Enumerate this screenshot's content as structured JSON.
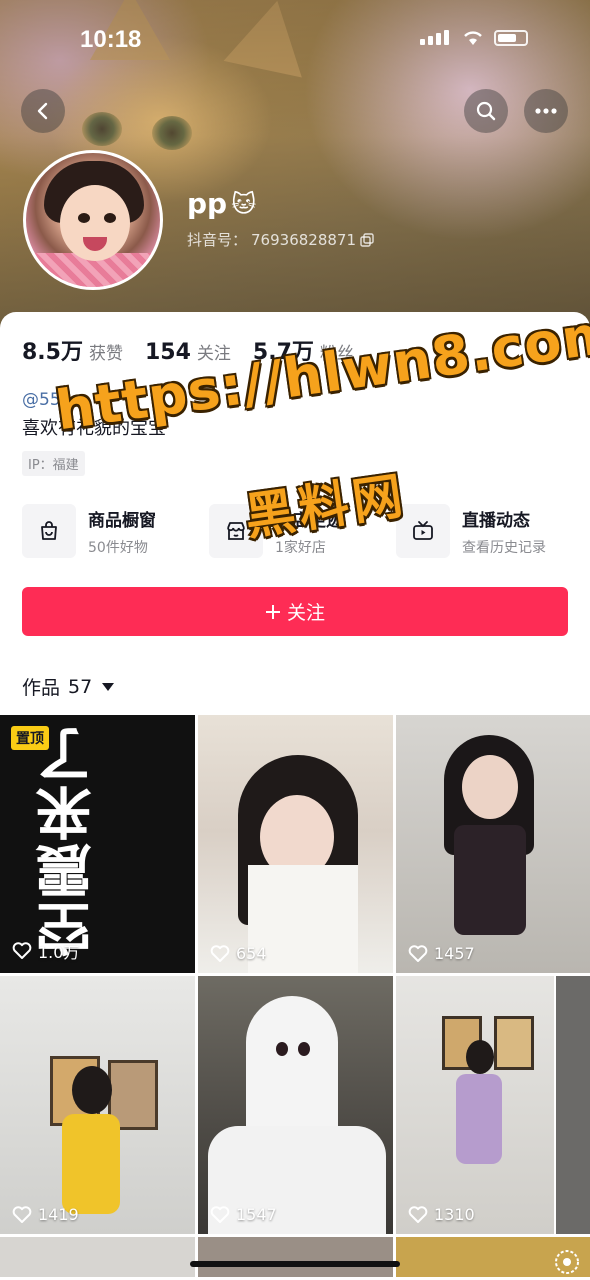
{
  "status_bar": {
    "time": "10:18"
  },
  "profile": {
    "nickname": "pp",
    "nickname_emoji": "🐱",
    "douyin_id_label": "抖音号：",
    "douyin_id": "76936828871",
    "stats": [
      {
        "value": "8.5万",
        "label": "获赞"
      },
      {
        "value": "154",
        "label": "关注"
      },
      {
        "value": "5.7万",
        "label": "粉丝"
      }
    ],
    "bio_mention": "@555、",
    "bio": "喜欢有礼貌的宝宝",
    "ip_location": "IP：福建"
  },
  "shortcuts": [
    {
      "title": "商品橱窗",
      "subtitle": "50件好物",
      "icon": "shop-window-icon"
    },
    {
      "title": "探店足迹",
      "subtitle": "1家好店",
      "icon": "store-icon"
    },
    {
      "title": "直播动态",
      "subtitle": "查看历史记录",
      "icon": "live-tv-icon"
    }
  ],
  "follow_button": {
    "label": "关注",
    "icon": "plus"
  },
  "works": {
    "label": "作品",
    "count": "57"
  },
  "tiles": [
    {
      "likes": "1.0万",
      "pinned_label": "置顶",
      "overlay_text": "空震来了"
    },
    {
      "likes": "654"
    },
    {
      "likes": "1457"
    },
    {
      "likes": "1419"
    },
    {
      "likes": "1547"
    },
    {
      "likes": "1310"
    }
  ],
  "watermark": {
    "url": "https://hlwn8.com",
    "name": "黑料网"
  },
  "colors": {
    "accent": "#fe2c55",
    "link": "#4a6fa5",
    "pin_badge": "#facc15",
    "watermark": "#f6a21c"
  }
}
